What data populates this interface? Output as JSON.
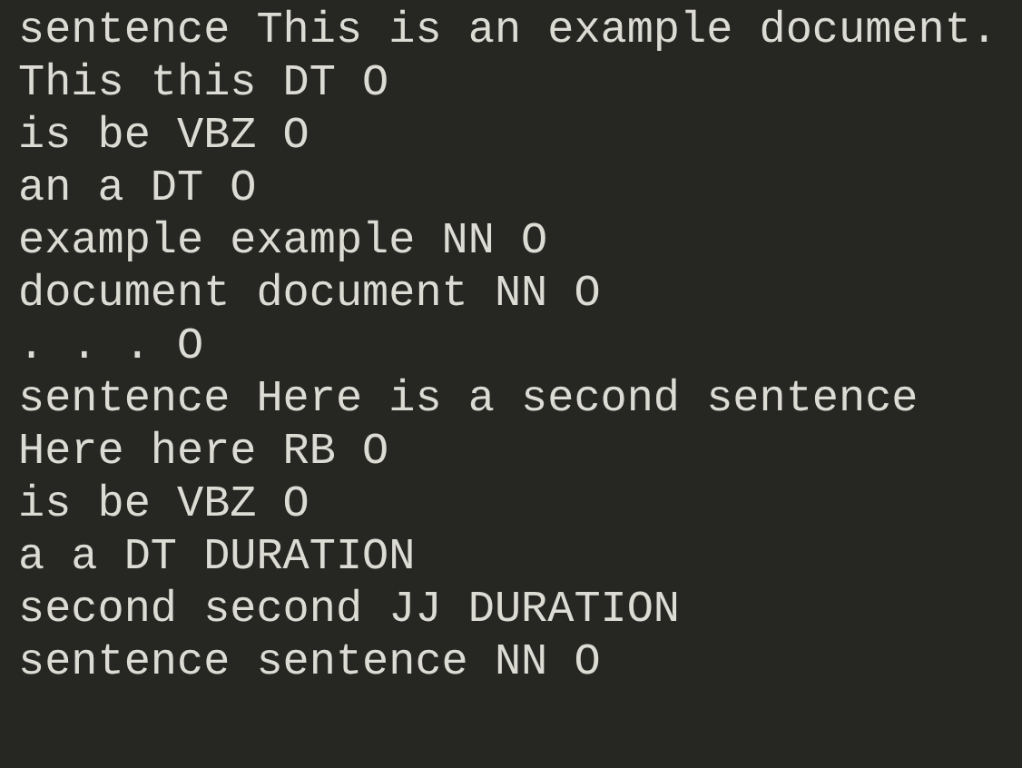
{
  "lines": [
    "sentence This is an example document.",
    "This this DT O",
    "is be VBZ O",
    "an a DT O",
    "example example NN O",
    "document document NN O",
    ". . . O",
    "sentence Here is a second sentence",
    "Here here RB O",
    "is be VBZ O",
    "a a DT DURATION",
    "second second JJ DURATION",
    "sentence sentence NN O"
  ]
}
